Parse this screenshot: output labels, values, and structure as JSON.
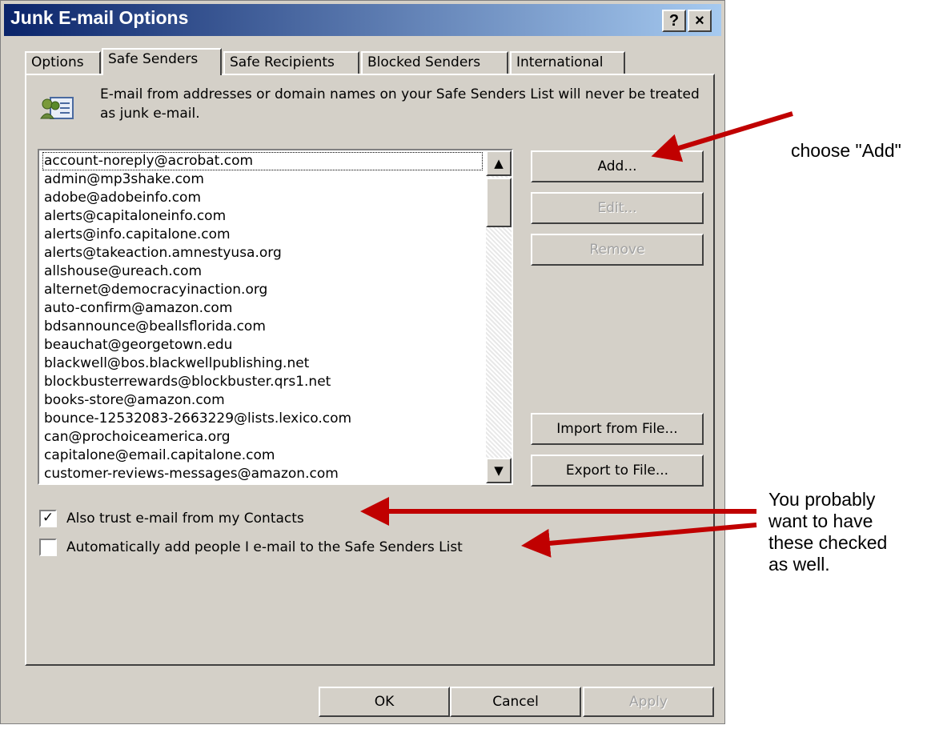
{
  "window": {
    "title": "Junk E-mail Options",
    "help_label": "?",
    "close_label": "×"
  },
  "tabs": [
    {
      "label": "Options"
    },
    {
      "label": "Safe Senders",
      "active": true
    },
    {
      "label": "Safe Recipients"
    },
    {
      "label": "Blocked Senders"
    },
    {
      "label": "International"
    }
  ],
  "info": {
    "icon": "contacts-icon",
    "text": "E-mail from addresses or domain names on your Safe Senders List will never be treated as junk e-mail."
  },
  "senders": [
    "account-noreply@acrobat.com",
    "admin@mp3shake.com",
    "adobe@adobeinfo.com",
    "alerts@capitaloneinfo.com",
    "alerts@info.capitalone.com",
    "alerts@takeaction.amnestyusa.org",
    "allshouse@ureach.com",
    "alternet@democracyinaction.org",
    "auto-confirm@amazon.com",
    "bdsannounce@beallsflorida.com",
    "beauchat@georgetown.edu",
    "blackwell@bos.blackwellpublishing.net",
    "blockbusterrewards@blockbuster.qrs1.net",
    "books-store@amazon.com",
    "bounce-12532083-2663229@lists.lexico.com",
    "can@prochoiceamerica.org",
    "capitalone@email.capitalone.com",
    "customer-reviews-messages@amazon.com"
  ],
  "buttons": {
    "add": "Add...",
    "edit": "Edit...",
    "remove": "Remove",
    "import": "Import from File...",
    "export": "Export to File...",
    "ok": "OK",
    "cancel": "Cancel",
    "apply": "Apply"
  },
  "options": {
    "trust_contacts": {
      "label": "Also trust e-mail from my Contacts",
      "checked": true
    },
    "auto_add": {
      "label": "Automatically add people I e-mail to the Safe Senders List",
      "checked": false
    }
  },
  "annotations": {
    "add_note": "choose \"Add\"",
    "check_note": [
      "You probably",
      "want to have",
      "these checked",
      "as well."
    ],
    "arrow_color": "#c00000"
  }
}
